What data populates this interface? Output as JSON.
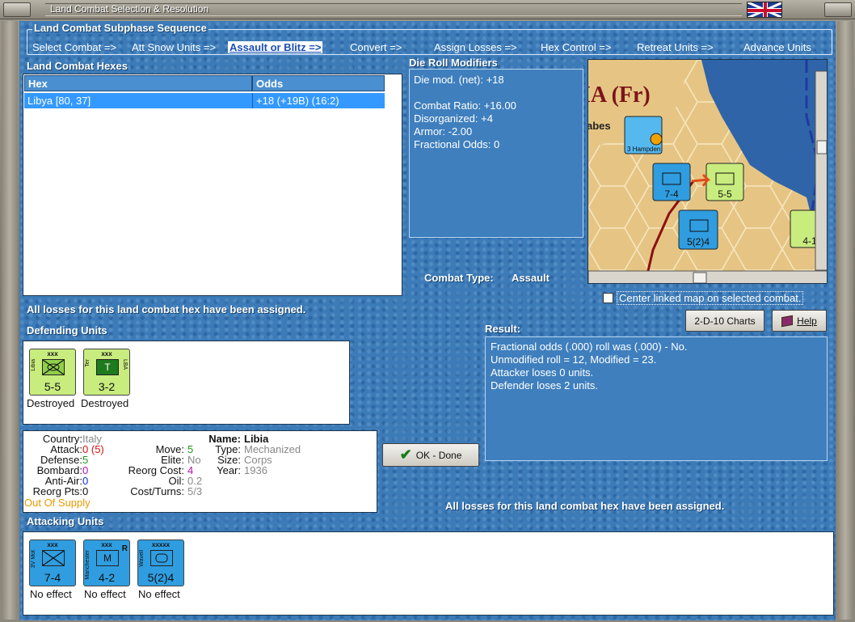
{
  "window": {
    "title": "Land Combat Selection & Resolution",
    "accent": "#3c7bb8"
  },
  "phase": {
    "title": "Land Combat Subphase Sequence",
    "steps": [
      "Select Combat =>",
      "Att Snow Units =>",
      "Assault or Blitz =>",
      "Convert =>",
      "Assign Losses =>",
      "Hex Control =>",
      "Retreat Units =>",
      "Advance Units"
    ],
    "active_index": 2
  },
  "hexes": {
    "title": "Land Combat Hexes",
    "columns": [
      "Hex",
      "Odds"
    ],
    "rows": [
      {
        "hex": "Libya [80, 37]",
        "odds": "+18 (+19B) (16:2)"
      }
    ]
  },
  "modifiers": {
    "title": "Die Roll Modifiers",
    "lines": [
      "Die mod. (net): +18",
      "",
      "Combat Ratio: +16.00",
      "Disorganized: +4",
      "Armor: -2.00",
      "Fractional Odds: 0"
    ]
  },
  "map": {
    "region_label": "IA (Fr)",
    "town_label": "abes",
    "center_linked_label": "Center linked map on selected combat.",
    "center_linked_checked": false
  },
  "combat_type": {
    "label": "Combat Type:",
    "value": "Assault"
  },
  "status_message": "All losses for this land combat hex have been assigned.",
  "status_message_2": "All losses for this land combat hex have been assigned.",
  "buttons": {
    "charts": "2-D-10 Charts",
    "help": "Help",
    "ok": "OK - Done"
  },
  "result": {
    "title": "Result:",
    "lines": [
      "Fractional odds (.000) roll was (.000)  - No.",
      "Unmodified roll = 12, Modified = 23.",
      "Attacker loses 0 units.",
      "Defender loses 2 units."
    ]
  },
  "defending": {
    "title": "Defending Units",
    "units": [
      {
        "name": "Libia",
        "strength": "5-5",
        "size": "xxx",
        "side": "Libia",
        "side_right": "",
        "status": "Destroyed"
      },
      {
        "name": "Ter",
        "strength": "3-2",
        "size": "xxx",
        "side": "Ter",
        "side_right": "LBA",
        "status": "Destroyed"
      }
    ]
  },
  "unit_details": {
    "country_label": "Country:",
    "country": "Italy",
    "attack_label": "Attack:",
    "attack": "0",
    "attack_alt": "(5)",
    "defense_label": "Defense:",
    "defense": "5",
    "bombard_label": "Bombard:",
    "bombard": "0",
    "antiair_label": "Anti-Air:",
    "antiair": "0",
    "reorg_pts_label": "Reorg Pts:",
    "reorg_pts": "0",
    "supply": "Out Of Supply",
    "move_label": "Move:",
    "move": "5",
    "elite_label": "Elite:",
    "elite": "No",
    "reorg_cost_label": "Reorg Cost:",
    "reorg_cost": "4",
    "oil_label": "Oil:",
    "oil": "0.2",
    "cost_turns_label": "Cost/Turns:",
    "cost_turns": "5/3",
    "name_label": "Name:",
    "name": "Libia",
    "type_label": "Type:",
    "type": "Mechanized",
    "size_label": "Size:",
    "size": "Corps",
    "year_label": "Year:",
    "year": "1936"
  },
  "attacking": {
    "title": "Attacking Units",
    "units": [
      {
        "name": "3V Mot",
        "strength": "7-4",
        "size": "xxx",
        "side": "3V Mot",
        "side_right": "",
        "status": "No effect"
      },
      {
        "name": "Manchester",
        "strength": "4-2",
        "size": "xxx",
        "side": "Manchester",
        "side_right": "R",
        "status": "No effect"
      },
      {
        "name": "Wavell",
        "strength": "5(2)4",
        "size": "xxxxx",
        "side": "Wavell",
        "side_right": "",
        "status": "No effect"
      }
    ]
  },
  "map_counters": [
    {
      "strength": "7-4"
    },
    {
      "strength": "5-5"
    },
    {
      "strength": "5(2)4"
    },
    {
      "strength": "4-1"
    },
    {
      "strength": "3 Hampden"
    }
  ]
}
